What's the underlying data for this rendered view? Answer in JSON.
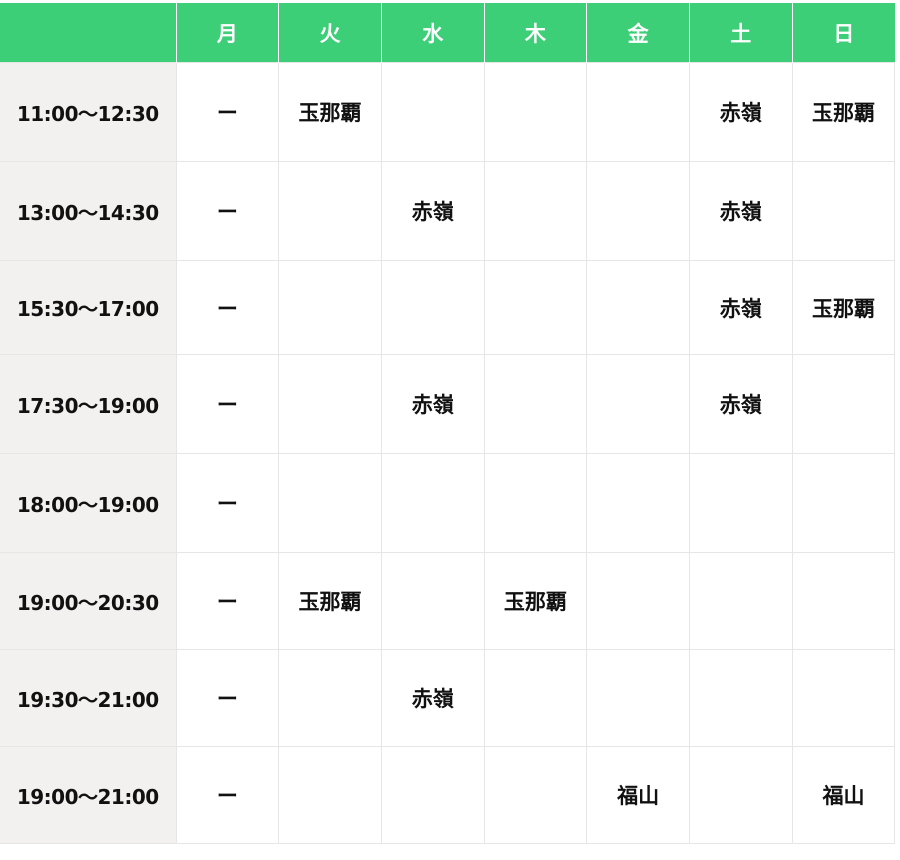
{
  "header": {
    "corner": "",
    "days": [
      "月",
      "火",
      "水",
      "木",
      "金",
      "土",
      "日"
    ]
  },
  "rows": [
    {
      "time": "11:00〜12:30",
      "cells": [
        "ー",
        "玉那覇",
        "",
        "",
        "",
        "赤嶺",
        "玉那覇"
      ]
    },
    {
      "time": "13:00〜14:30",
      "cells": [
        "ー",
        "",
        "赤嶺",
        "",
        "",
        "赤嶺",
        ""
      ]
    },
    {
      "time": "15:30〜17:00",
      "cells": [
        "ー",
        "",
        "",
        "",
        "",
        "赤嶺",
        "玉那覇"
      ]
    },
    {
      "time": "17:30〜19:00",
      "cells": [
        "ー",
        "",
        "赤嶺",
        "",
        "",
        "赤嶺",
        ""
      ]
    },
    {
      "time": "18:00〜19:00",
      "cells": [
        "ー",
        "",
        "",
        "",
        "",
        "",
        ""
      ]
    },
    {
      "time": "19:00〜20:30",
      "cells": [
        "ー",
        "玉那覇",
        "",
        "玉那覇",
        "",
        "",
        ""
      ]
    },
    {
      "time": "19:30〜21:00",
      "cells": [
        "ー",
        "",
        "赤嶺",
        "",
        "",
        "",
        ""
      ]
    },
    {
      "time": "19:00〜21:00",
      "cells": [
        "ー",
        "",
        "",
        "",
        "福山",
        "",
        "福山"
      ]
    }
  ],
  "colors": {
    "header_bg": "#3ccf78",
    "time_col_bg": "#f3f1ef",
    "grid_line": "#e6e6e6"
  }
}
